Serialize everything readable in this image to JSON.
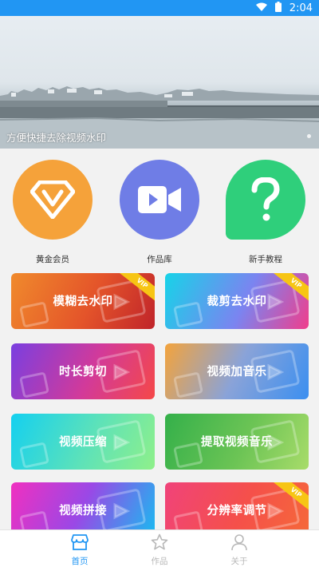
{
  "status_bar": {
    "time": "2:04",
    "icons": [
      "wifi-icon",
      "battery-icon"
    ]
  },
  "banner": {
    "caption": "方便快捷去除视频水印"
  },
  "quick_actions": [
    {
      "label": "黄金会员",
      "icon": "diamond-v-icon",
      "color": "#f5a23a"
    },
    {
      "label": "作品库",
      "icon": "video-camera-icon",
      "color": "#6f7de6"
    },
    {
      "label": "新手教程",
      "icon": "question-icon",
      "color": "#2fcf7b"
    }
  ],
  "features": [
    {
      "label": "模糊去水印",
      "vip": "VIP"
    },
    {
      "label": "裁剪去水印",
      "vip": "VIP"
    },
    {
      "label": "时长剪切"
    },
    {
      "label": "视频加音乐"
    },
    {
      "label": "视频压缩"
    },
    {
      "label": "提取视频音乐"
    },
    {
      "label": "视频拼接"
    },
    {
      "label": "分辨率调节",
      "vip": "VIP"
    }
  ],
  "tabbar": {
    "active_color": "#2196f3",
    "inactive_color": "#b8b8b8",
    "tabs": [
      {
        "label": "首页",
        "icon": "home-icon",
        "active": true
      },
      {
        "label": "作品",
        "icon": "star-icon",
        "active": false
      },
      {
        "label": "关于",
        "icon": "user-icon",
        "active": false
      }
    ]
  }
}
